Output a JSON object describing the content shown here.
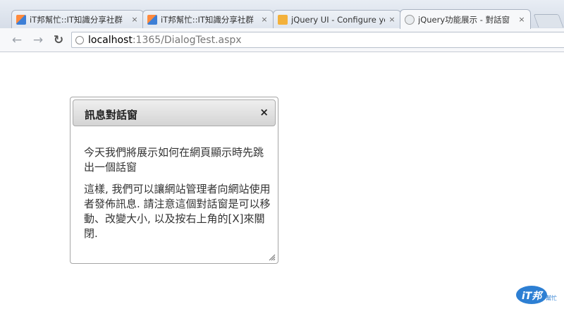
{
  "browser": {
    "tabs": [
      {
        "title": "iT邦幫忙::IT知識分享社群",
        "close": "×",
        "icon": "ithome-icon"
      },
      {
        "title": "iT邦幫忙::IT知識分享社群",
        "close": "×",
        "icon": "ithome-icon"
      },
      {
        "title": "jQuery UI - Configure you",
        "close": "×",
        "icon": "jquery-ui-icon"
      },
      {
        "title": "jQuery功能展示 - 對話窗",
        "close": "×",
        "icon": "globe-icon"
      }
    ],
    "active_tab": 3,
    "address": {
      "host": "localhost",
      "path": ":1365/DialogTest.aspx"
    }
  },
  "dialog": {
    "title": "訊息對話窗",
    "close_symbol": "×",
    "paragraphs": [
      "今天我們將展示如何在網頁顯示時先跳出一個話窗",
      "這樣, 我們可以讓網站管理者向網站使用者發佈訊息. 請注意這個對話窗是可以移動、改變大小, 以及按右上角的[X]來關閉."
    ]
  },
  "watermark": {
    "brand": "iT邦",
    "sub": "幫忙"
  }
}
